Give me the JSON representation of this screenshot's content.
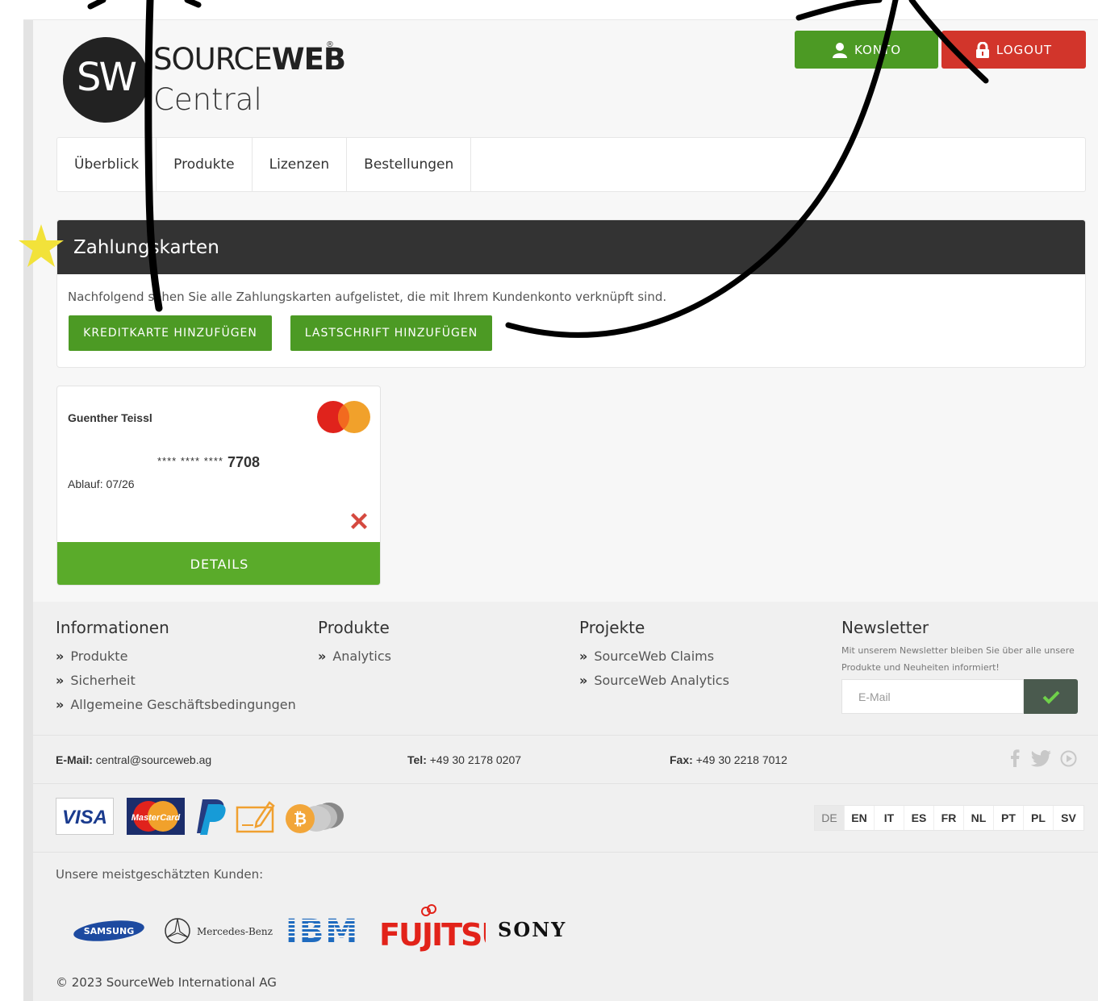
{
  "logo": {
    "mark": "SW",
    "name_light": "SOURCE",
    "name_bold": "WEB",
    "registered": "®",
    "subtitle": "Central"
  },
  "header": {
    "konto_label": "KONTO",
    "logout_label": "LOGOUT"
  },
  "nav": {
    "items": [
      {
        "label": "Überblick"
      },
      {
        "label": "Produkte"
      },
      {
        "label": "Lizenzen"
      },
      {
        "label": "Bestellungen"
      }
    ]
  },
  "payment": {
    "title": "Zahlungskarten",
    "description": "Nachfolgend sehen Sie alle Zahlungskarten aufgelistet, die mit Ihrem Kundenkonto verknüpft sind.",
    "add_credit_label": "KREDITKARTE HINZUFÜGEN",
    "add_debit_label": "LASTSCHRIFT HINZUFÜGEN"
  },
  "card": {
    "holder": "Guenther Teissl",
    "number_mask": "**** **** ****",
    "number_last": "7708",
    "expiry": "Ablauf: 07/26",
    "brand_icon": "mastercard-icon",
    "delete_icon": "close-icon",
    "details_label": "DETAILS"
  },
  "footer": {
    "info": {
      "title": "Informationen",
      "links": [
        "Produkte",
        "Sicherheit",
        "Allgemeine Geschäftsbedingungen"
      ]
    },
    "products": {
      "title": "Produkte",
      "links": [
        "Analytics"
      ]
    },
    "projects": {
      "title": "Projekte",
      "links": [
        "SourceWeb Claims",
        "SourceWeb Analytics"
      ]
    },
    "newsletter": {
      "title": "Newsletter",
      "text": "Mit unserem Newsletter bleiben Sie über alle unsere Produkte und Neuheiten informiert!",
      "placeholder": "E-Mail"
    },
    "contact": {
      "email_label": "E-Mail:",
      "email": "central@sourceweb.ag",
      "tel_label": "Tel:",
      "tel": "+49 30 2178 0207",
      "fax_label": "Fax:",
      "fax": "+49 30 2218 7012"
    },
    "social_icons": [
      "facebook-icon",
      "twitter-icon",
      "play-icon"
    ],
    "payment_icons": {
      "visa": "VISA",
      "mastercard": "MasterCard",
      "items": [
        "visa-icon",
        "mastercard-icon",
        "paypal-icon",
        "invoice-icon",
        "bitcoin-icon"
      ]
    },
    "languages": [
      "DE",
      "EN",
      "IT",
      "ES",
      "FR",
      "NL",
      "PT",
      "PL",
      "SV"
    ],
    "active_language": "DE",
    "clients_label": "Unsere meistgeschätzten Kunden:",
    "clients": {
      "samsung": "SAMSUNG",
      "mercedes": "Mercedes-Benz",
      "ibm": "IBM",
      "fujitsu": "FUJITSU",
      "sony": "SONY"
    },
    "copyright": "© 2023 SourceWeb International AG"
  },
  "colors": {
    "green": "#4c9a24",
    "details_green": "#5aab2a",
    "red": "#d2352b",
    "header_dark": "#333333",
    "star": "#f2e23a"
  }
}
